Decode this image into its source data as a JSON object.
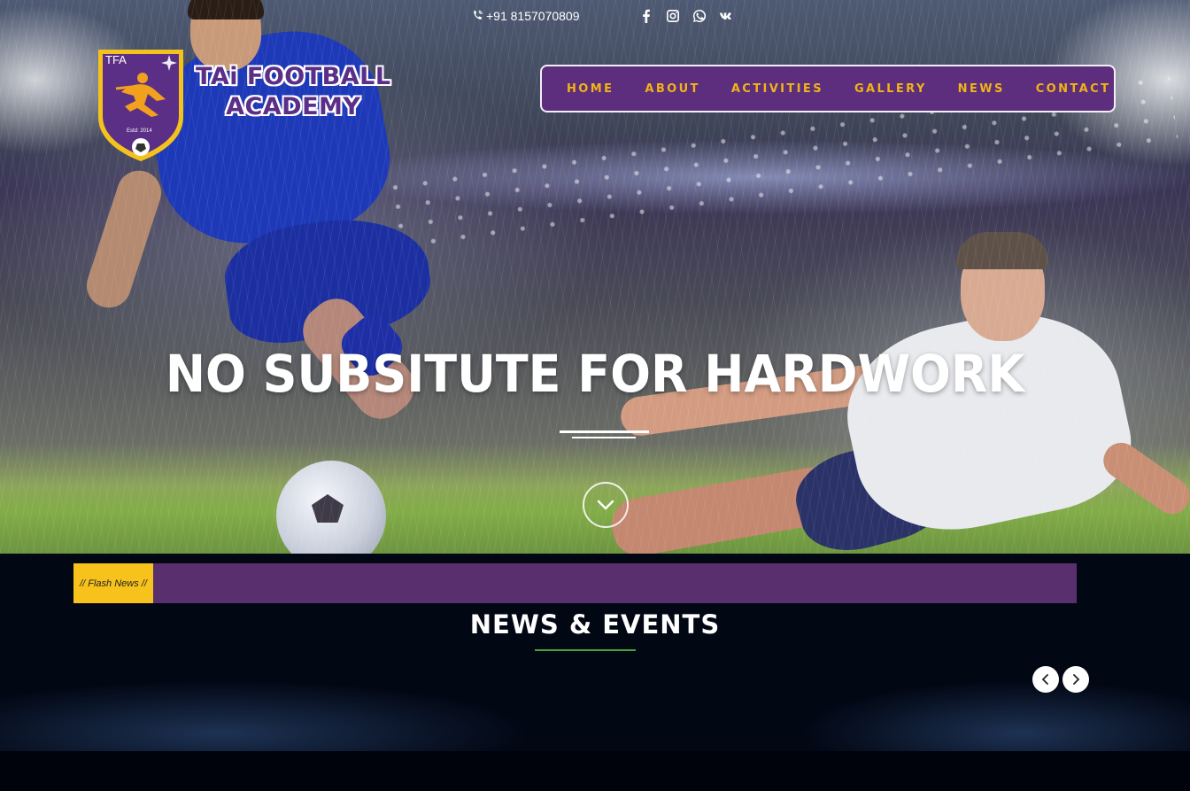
{
  "contact": {
    "phone": "+91 8157070809",
    "socials": [
      "facebook-icon",
      "instagram-icon",
      "whatsapp-icon",
      "vk-icon"
    ]
  },
  "logo": {
    "crest_abbr": "TFA",
    "crest_est": "Estd: 2014",
    "line1": "TAi FOOTBALL",
    "line2": "ACADEMY"
  },
  "nav": {
    "items": [
      "HOME",
      "ABOUT",
      "ACTIVITIES",
      "GALLERY",
      "NEWS",
      "CONTACT"
    ]
  },
  "hero": {
    "headline": "NO SUBSITUTE FOR HARDWORK"
  },
  "news": {
    "flash_label": "// Flash News //",
    "flash_text": "",
    "section_title": "NEWS & EVENTS"
  },
  "colors": {
    "brand_purple": "#5d2e7e",
    "accent_gold": "#f2b316",
    "flash_yellow": "#f6c21b",
    "title_rule_green": "#46a23c",
    "section_bg": "#020714"
  }
}
